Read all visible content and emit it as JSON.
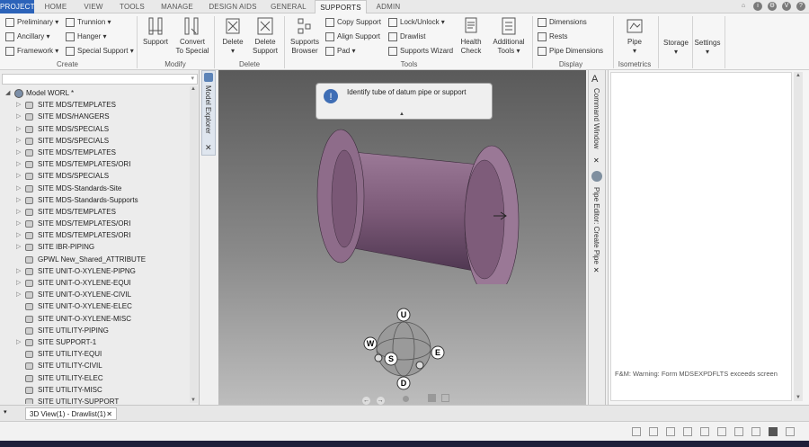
{
  "tabs": [
    {
      "label": "PROJECT"
    },
    {
      "label": "HOME"
    },
    {
      "label": "VIEW"
    },
    {
      "label": "TOOLS"
    },
    {
      "label": "MANAGE"
    },
    {
      "label": "DESIGN AIDS"
    },
    {
      "label": "GENERAL"
    },
    {
      "label": "SUPPORTS"
    },
    {
      "label": "ADMIN"
    }
  ],
  "ribbon": {
    "create": {
      "preliminary": "Preliminary",
      "trunnion": "Trunnion",
      "ancillary": "Ancillary",
      "hanger": "Hanger",
      "framework": "Framework",
      "special_support": "Special Support",
      "label": "Create"
    },
    "modify": {
      "support": "Support",
      "convert1": "Convert",
      "convert2": "To Special",
      "label": "Modify"
    },
    "delete": {
      "delete": "Delete",
      "delete_support1": "Delete",
      "delete_support2": "Support",
      "label": "Delete"
    },
    "tools": {
      "browser1": "Supports",
      "browser2": "Browser",
      "copy_support": "Copy Support",
      "align_support": "Align Support",
      "pad": "Pad",
      "lock_unlock": "Lock/Unlock",
      "drawlist": "Drawlist",
      "supports_wizard": "Supports Wizard",
      "health1": "Health",
      "health2": "Check",
      "additional1": "Additional",
      "additional2": "Tools",
      "label": "Tools"
    },
    "display": {
      "dimensions": "Dimensions",
      "rests": "Rests",
      "pipe_dimensions": "Pipe Dimensions",
      "label": "Display"
    },
    "isometrics": {
      "pipe": "Pipe",
      "label": "Isometrics"
    },
    "storage": "Storage",
    "settings": "Settings"
  },
  "sidebar": {
    "title": "Model Explorer",
    "root": "Model WORL *",
    "items": [
      {
        "label": "SITE MDS/TEMPLATES",
        "has_children": true
      },
      {
        "label": "SITE MDS/HANGERS",
        "has_children": true
      },
      {
        "label": "SITE MDS/SPECIALS",
        "has_children": true
      },
      {
        "label": "SITE MDS/SPECIALS",
        "has_children": true
      },
      {
        "label": "SITE MDS/TEMPLATES",
        "has_children": true
      },
      {
        "label": "SITE MDS/TEMPLATES/ORI",
        "has_children": true
      },
      {
        "label": "SITE MDS/SPECIALS",
        "has_children": true
      },
      {
        "label": "SITE MDS-Standards-Site",
        "has_children": true
      },
      {
        "label": "SITE MDS-Standards-Supports",
        "has_children": true
      },
      {
        "label": "SITE MDS/TEMPLATES",
        "has_children": true
      },
      {
        "label": "SITE MDS/TEMPLATES/ORI",
        "has_children": true
      },
      {
        "label": "SITE MDS/TEMPLATES/ORI",
        "has_children": true
      },
      {
        "label": "SITE IBR-PIPING",
        "has_children": true
      },
      {
        "label": "GPWL New_Shared_ATTRIBUTE",
        "has_children": false
      },
      {
        "label": "SITE UNIT-O-XYLENE-PIPNG",
        "has_children": true
      },
      {
        "label": "SITE UNIT-O-XYLENE-EQUI",
        "has_children": true
      },
      {
        "label": "SITE UNIT-O-XYLENE-CIVIL",
        "has_children": true
      },
      {
        "label": "SITE UNIT-O-XYLENE-ELEC",
        "has_children": false
      },
      {
        "label": "SITE UNIT-O-XYLENE-MISC",
        "has_children": false
      },
      {
        "label": "SITE UTILITY-PIPING",
        "has_children": false
      },
      {
        "label": "SITE SUPPORT-1",
        "has_children": true
      },
      {
        "label": "SITE UTILITY-EQUI",
        "has_children": false
      },
      {
        "label": "SITE UTILITY-CIVIL",
        "has_children": false
      },
      {
        "label": "SITE UTILITY-ELEC",
        "has_children": false
      },
      {
        "label": "SITE UTILITY-MISC",
        "has_children": false
      },
      {
        "label": "SITE UTILITY-SUPPORT",
        "has_children": false
      }
    ]
  },
  "viewport": {
    "prompt": "Identify tube of datum pipe or support",
    "gizmo": {
      "up": "U",
      "down": "D",
      "west": "W",
      "east": "E",
      "south": "S"
    }
  },
  "right_tabs": {
    "command_window": "Command Window",
    "pipe_editor": "Pipe Editor: Create Pipe"
  },
  "command": {
    "message": "F&M: Warning: Form MDSEXPDFLTS exceeds screen"
  },
  "doc_tab": {
    "label": "3D View(1) - Drawlist(1)"
  },
  "colors": {
    "accent": "#2c63b9",
    "pipe": "#7c5a78"
  }
}
